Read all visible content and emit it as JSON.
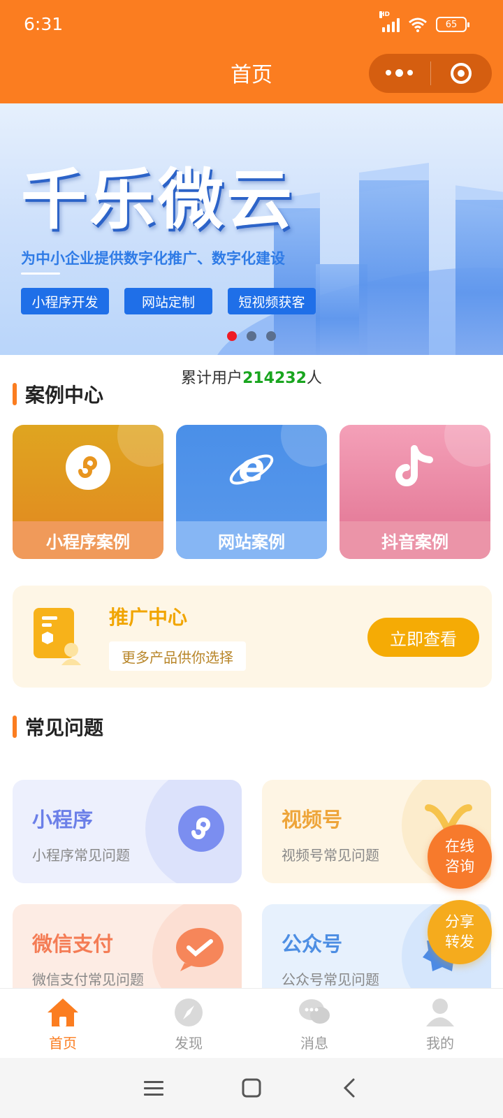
{
  "status_bar": {
    "time": "6:31",
    "network": "HD",
    "battery": "65"
  },
  "header": {
    "title": "首页"
  },
  "banner": {
    "title": "千乐微云",
    "subtitle": "为中小企业提供数字化推广、数字化建设",
    "tags": [
      "小程序开发",
      "网站定制",
      "短视频获客"
    ],
    "active_slide": 1,
    "slide_count": 3
  },
  "users": {
    "prefix": "累计用户",
    "count": "214232",
    "suffix": "人"
  },
  "case_section": {
    "title": "案例中心",
    "cards": [
      {
        "label": "小程序案例",
        "icon": "mini-program-icon"
      },
      {
        "label": "网站案例",
        "icon": "ie-icon"
      },
      {
        "label": "抖音案例",
        "icon": "douyin-icon"
      }
    ]
  },
  "promo": {
    "title": "推广中心",
    "subtitle": "更多产品供你选择",
    "button": "立即查看"
  },
  "faq_section": {
    "title": "常见问题",
    "items": [
      {
        "title": "小程序",
        "subtitle": "小程序常见问题"
      },
      {
        "title": "视频号",
        "subtitle": "视频号常见问题"
      },
      {
        "title": "微信支付",
        "subtitle": "微信支付常见问题"
      },
      {
        "title": "公众号",
        "subtitle": "公众号常见问题"
      }
    ]
  },
  "floating": {
    "consult_line1": "在线",
    "consult_line2": "咨询",
    "share_line1": "分享",
    "share_line2": "转发"
  },
  "tabbar": {
    "items": [
      {
        "label": "首页",
        "icon": "home-icon",
        "active": true
      },
      {
        "label": "发现",
        "icon": "compass-icon",
        "active": false
      },
      {
        "label": "消息",
        "icon": "chat-icon",
        "active": false
      },
      {
        "label": "我的",
        "icon": "user-icon",
        "active": false
      }
    ]
  },
  "colors": {
    "brand": "#fb7d20",
    "highlight_green": "#19a51f",
    "promo_gold": "#f5ab05"
  }
}
